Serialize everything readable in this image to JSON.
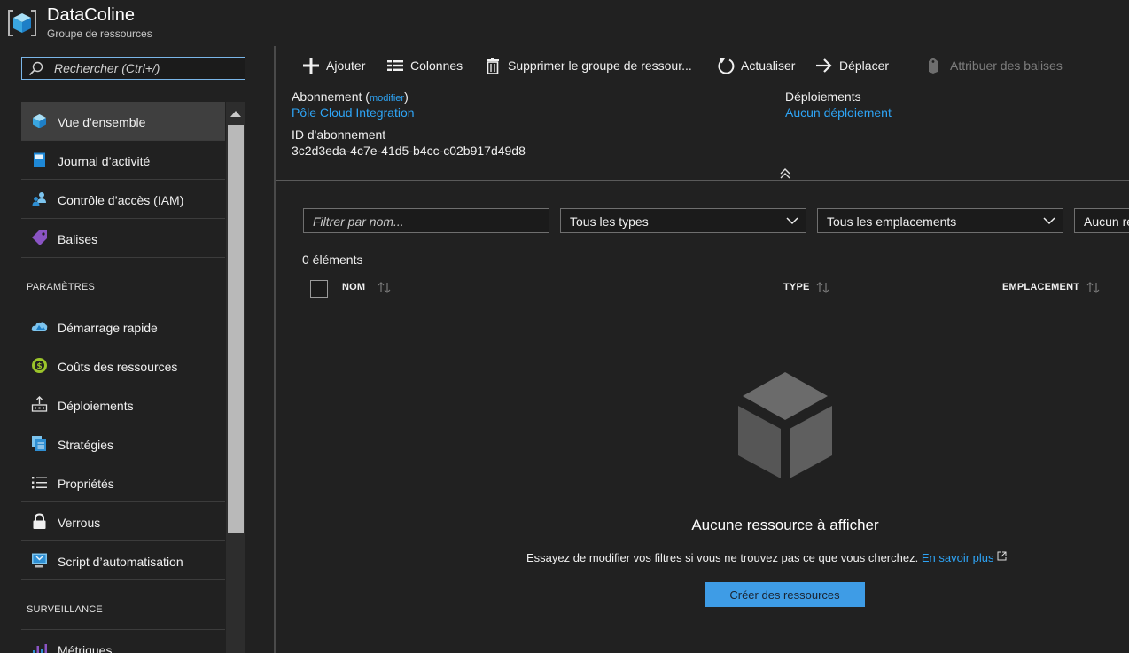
{
  "header": {
    "title": "DataColine",
    "subtitle": "Groupe de ressources"
  },
  "sidebar": {
    "search_placeholder": "Rechercher (Ctrl+/)",
    "items": [
      {
        "label": "Vue d'ensemble",
        "icon": "cube-icon",
        "selected": true
      },
      {
        "label": "Journal d’activité",
        "icon": "book-icon"
      },
      {
        "label": "Contrôle d’accès (IAM)",
        "icon": "users-icon"
      },
      {
        "label": "Balises",
        "icon": "tag-icon"
      }
    ],
    "section_params": "PARAMÈTRES",
    "params_items": [
      {
        "label": "Démarrage rapide",
        "icon": "cloud-icon"
      },
      {
        "label": "Coûts des ressources",
        "icon": "cost-icon"
      },
      {
        "label": "Déploiements",
        "icon": "deploy-icon"
      },
      {
        "label": "Stratégies",
        "icon": "policy-icon"
      },
      {
        "label": "Propriétés",
        "icon": "list-icon"
      },
      {
        "label": "Verrous",
        "icon": "lock-icon"
      },
      {
        "label": "Script d’automatisation",
        "icon": "script-icon"
      }
    ],
    "section_monitoring": "SURVEILLANCE",
    "monitoring_items": [
      {
        "label": "Métriques",
        "icon": "metrics-icon"
      }
    ]
  },
  "toolbar": {
    "add": "Ajouter",
    "columns": "Colonnes",
    "delete": "Supprimer le groupe de ressour...",
    "refresh": "Actualiser",
    "move": "Déplacer",
    "tags": "Attribuer des balises"
  },
  "essentials": {
    "subscription_label": "Abonnement",
    "modify_link": "modifier",
    "subscription_value": "Pôle Cloud Integration",
    "subscription_id_label": "ID d'abonnement",
    "subscription_id_value": "3c2d3eda-4c7e-41d5-b4cc-c02b917d49d8",
    "deployments_label": "Déploiements",
    "deployments_value": "Aucun déploiement"
  },
  "filters": {
    "name_placeholder": "Filtrer par nom...",
    "types": "Tous les types",
    "locations": "Tous les emplacements",
    "tags": "Aucun regroupement"
  },
  "table": {
    "count": "0 éléments",
    "col_name": "NOM",
    "col_type": "TYPE",
    "col_location": "EMPLACEMENT"
  },
  "empty_state": {
    "title": "Aucune ressource à afficher",
    "message": "Essayez de modifier vos filtres si vous ne trouvez pas ce que vous cherchez.",
    "learn_more": "En savoir plus",
    "create_button": "Créer des ressources"
  },
  "colors": {
    "background": "#212121",
    "link": "#2ea4f5",
    "primary_button": "#3e9ce6",
    "selected_nav": "#3f3f3f"
  }
}
